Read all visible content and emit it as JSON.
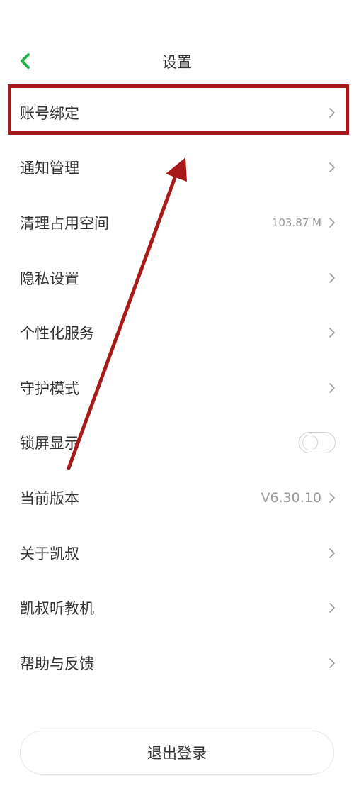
{
  "header": {
    "title": "设置",
    "back_icon": "chevron-left-icon",
    "accent_color": "#22b14c"
  },
  "settings": [
    {
      "label": "账号绑定",
      "value": "",
      "control": "chevron"
    },
    {
      "label": "通知管理",
      "value": "",
      "control": "chevron"
    },
    {
      "label": "清理占用空间",
      "value": "103.87 M",
      "control": "chevron"
    },
    {
      "label": "隐私设置",
      "value": "",
      "control": "chevron"
    },
    {
      "label": "个性化服务",
      "value": "",
      "control": "chevron"
    },
    {
      "label": "守护模式",
      "value": "",
      "control": "chevron"
    },
    {
      "label": "锁屏显示",
      "value": "",
      "control": "toggle",
      "toggle_on": false
    },
    {
      "label": "当前版本",
      "value": "V6.30.10",
      "control": "chevron"
    },
    {
      "label": "关于凯叔",
      "value": "",
      "control": "chevron"
    },
    {
      "label": "凯叔听教机",
      "value": "",
      "control": "chevron"
    },
    {
      "label": "帮助与反馈",
      "value": "",
      "control": "chevron"
    }
  ],
  "logout": {
    "label": "退出登录"
  },
  "annotation": {
    "color": "#a81a1a"
  }
}
